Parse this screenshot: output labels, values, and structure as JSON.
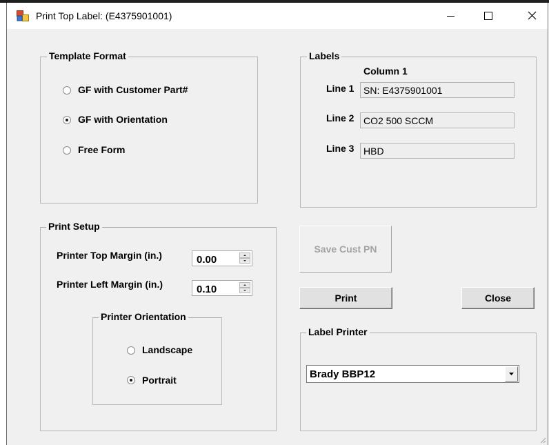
{
  "window": {
    "title": "Print Top Label: (E4375901001)",
    "icons": {
      "app": "app-form-icon",
      "minimize": "minimize-icon",
      "maximize": "maximize-icon",
      "close": "close-icon"
    }
  },
  "template_format": {
    "legend": "Template Format",
    "options": [
      {
        "label": "GF with Customer Part#",
        "checked": false
      },
      {
        "label": "GF with Orientation",
        "checked": true
      },
      {
        "label": "Free Form",
        "checked": false
      }
    ]
  },
  "labels": {
    "legend": "Labels",
    "column_header": "Column 1",
    "lines": [
      {
        "label": "Line 1",
        "value": "SN: E4375901001"
      },
      {
        "label": "Line 2",
        "value": "CO2 500 SCCM"
      },
      {
        "label": "Line 3",
        "value": "HBD"
      }
    ]
  },
  "print_setup": {
    "legend": "Print Setup",
    "top_margin_label": "Printer Top Margin (in.)",
    "top_margin_value": "0.00",
    "left_margin_label": "Printer Left Margin (in.)",
    "left_margin_value": "0.10",
    "orientation": {
      "legend": "Printer Orientation",
      "options": [
        {
          "label": "Landscape",
          "checked": false
        },
        {
          "label": "Portrait",
          "checked": true
        }
      ]
    }
  },
  "buttons": {
    "save_cust_pn": "Save Cust PN",
    "print": "Print",
    "close": "Close"
  },
  "label_printer": {
    "legend": "Label Printer",
    "selected": "Brady BBP12"
  }
}
